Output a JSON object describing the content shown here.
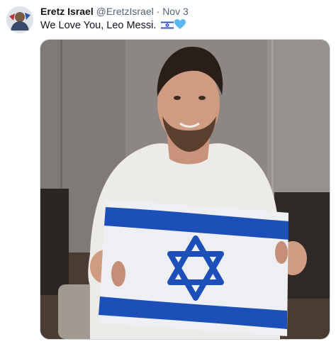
{
  "tweet": {
    "author": {
      "display_name": "Eretz Israel",
      "handle": "@EretzIsrael",
      "separator": "·",
      "timestamp": "Nov 3",
      "avatar_icon": "avatar-image"
    },
    "text": "We Love You, Leo Messi.",
    "emoji": [
      "israel-flag-emoji",
      "blue-heart-emoji"
    ],
    "media": {
      "type": "photo",
      "subject": "person holding Israel flag"
    }
  },
  "colors": {
    "flag_blue": "#1d4fb8",
    "heart_blue": "#5db7f0",
    "secondary_text": "#536471",
    "border": "#cfd9de"
  }
}
